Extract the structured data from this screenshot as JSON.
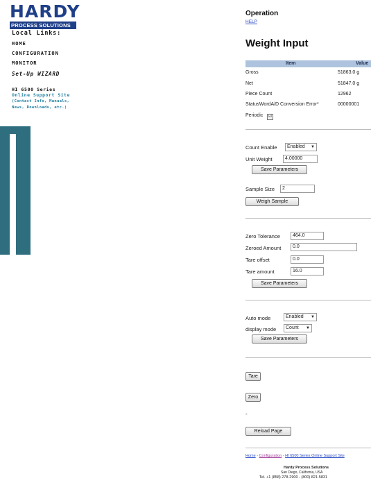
{
  "sidebar": {
    "logo_big": "HARDY",
    "logo_sub": "PROCESS SOLUTIONS",
    "local_links": "Local Links:",
    "links": [
      "HOME",
      "CONFIGURATION",
      "MONITOR"
    ],
    "wizard": "Set-Up WIZARD",
    "series": "HI 6500 Series",
    "support": "Online Support Site",
    "contact_line1": "(Contact Info, Manuals,",
    "contact_line2": "News, Downloads, etc.)",
    "accent_color": "#2f6e7f"
  },
  "header": {
    "operation": "Operation",
    "help": "HELP",
    "title": "Weight Input"
  },
  "table": {
    "col_item": "Item",
    "col_value": "Value",
    "rows": [
      {
        "label": "Gross",
        "value": "51863.0 g"
      },
      {
        "label": "Net",
        "value": "51847.0 g"
      },
      {
        "label": "Piece Count",
        "value": "12962"
      },
      {
        "label": "StatusWordA/D Conversion Error*",
        "value": "00000001"
      }
    ],
    "periodic_label": "Periodic",
    "periodic_checked": "☑"
  },
  "count_section": {
    "count_enable_label": "Count Enable",
    "count_enable_value": "Enabled",
    "unit_weight_label": "Unit Weight",
    "unit_weight_value": "4.00000",
    "save_label": "Save Parameters",
    "sample_size_label": "Sample Size",
    "sample_size_value": "2",
    "weigh_sample_label": "Weigh Sample"
  },
  "zero_section": {
    "zero_tolerance_label": "Zero Tolerance",
    "zero_tolerance_value": "464.0",
    "zeroed_amount_label": "Zeroed Amount",
    "zeroed_amount_value": "0.0",
    "tare_offset_label": "Tare offset",
    "tare_offset_value": "0.0",
    "tare_amount_label": "Tare amount",
    "tare_amount_value": "16.0",
    "save_label": "Save Parameters"
  },
  "mode_section": {
    "auto_mode_label": "Auto mode",
    "auto_mode_value": "Enabled",
    "display_mode_label": "display mode",
    "display_mode_value": "Count",
    "save_label": "Save Parameters"
  },
  "actions": {
    "tare": "Tare",
    "zero": "Zero",
    "dash": "-",
    "reload": "Reload Page"
  },
  "footer": {
    "home": "Home",
    "sep": " - ",
    "configuration": "Configuration",
    "support_link": "HI 6500 Series Online Support Site",
    "company": "Hardy Process Solutions",
    "city": "San Diego, California, USA",
    "phone": "Tel. +1 (858) 278-2900 - (800) 821-5831"
  }
}
